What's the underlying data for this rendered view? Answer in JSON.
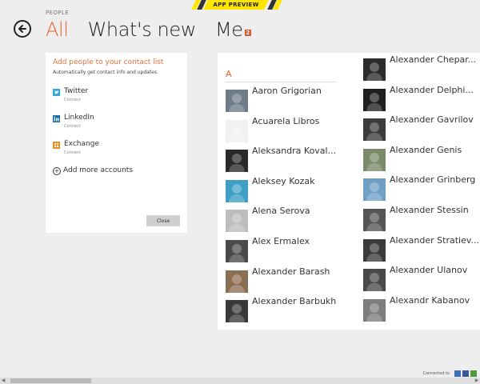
{
  "banner": {
    "label": "APP PREVIEW"
  },
  "app_name": "PEOPLE",
  "pivots": [
    {
      "label": "All",
      "active": true
    },
    {
      "label": "What's new",
      "active": false
    },
    {
      "label": "Me",
      "active": false,
      "badge": "2"
    }
  ],
  "setup": {
    "title": "Add people to your contact list",
    "subtitle": "Automatically get contact info and updates.",
    "accounts": [
      {
        "name": "Twitter",
        "status": "Connect",
        "icon": "twitter-icon",
        "color": "#2fa9e0"
      },
      {
        "name": "LinkedIn",
        "status": "Connect",
        "icon": "linkedin-icon",
        "color": "#1c6fa7"
      },
      {
        "name": "Exchange",
        "status": "Connect",
        "icon": "exchange-icon",
        "color": "#f08c1e"
      }
    ],
    "add_more": "Add more accounts",
    "close_label": "Close"
  },
  "contacts": {
    "group_letter": "A",
    "left": [
      {
        "name": "Aaron Grigorian",
        "avatar": "#6e7c8a"
      },
      {
        "name": "Acuarela Libros",
        "avatar": "#f2f2f2"
      },
      {
        "name": "Aleksandra Koval...",
        "avatar": "#2a2a2a"
      },
      {
        "name": "Aleksey Kozak",
        "avatar": "#3f9ec6"
      },
      {
        "name": "Alena Serova",
        "avatar": "#bdbdbd"
      },
      {
        "name": "Alex Ermalex",
        "avatar": "#4a4a4a"
      },
      {
        "name": "Alexander Barash",
        "avatar": "#8b6d52"
      },
      {
        "name": "Alexander Barbukh",
        "avatar": "#3a3a3a"
      }
    ],
    "right": [
      {
        "name": "Alexander Chepar...",
        "avatar": "#2b2b2b"
      },
      {
        "name": "Alexander Delphi...",
        "avatar": "#1f1f1f"
      },
      {
        "name": "Alexander Gavrilov",
        "avatar": "#3c3c3c"
      },
      {
        "name": "Alexander Genis",
        "avatar": "#7a8a6a"
      },
      {
        "name": "Alexander Grinberg",
        "avatar": "#6f9fc5"
      },
      {
        "name": "Alexander Stessin",
        "avatar": "#555555"
      },
      {
        "name": "Alexander Stratiev...",
        "avatar": "#3b3b3b"
      },
      {
        "name": "Alexander Ulanov",
        "avatar": "#4a4a4a"
      },
      {
        "name": "Alexandr Kabanov",
        "avatar": "#7d7d7d"
      }
    ]
  },
  "footer": {
    "label": "Connected to",
    "services": [
      {
        "icon": "messenger-icon",
        "color": "#3b6fb6"
      },
      {
        "icon": "facebook-icon",
        "color": "#3b5998"
      },
      {
        "icon": "google-icon",
        "color": "#4c9a3b"
      }
    ]
  },
  "colors": {
    "accent": "#e8632d",
    "background": "#eeeeee",
    "panel": "#ffffff"
  }
}
